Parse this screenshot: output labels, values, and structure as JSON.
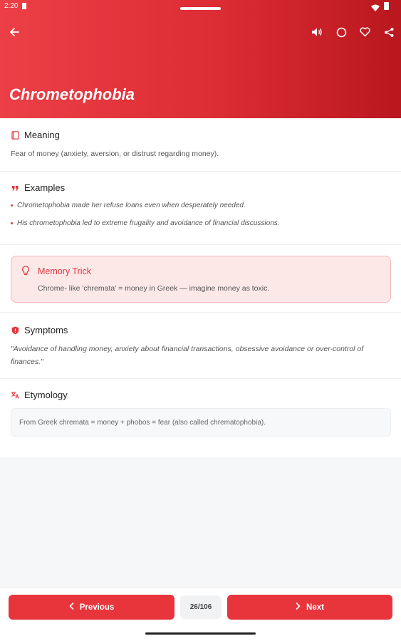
{
  "status_bar": {
    "time": "2:20"
  },
  "header": {
    "title": "Chrometophobia",
    "icons": [
      "back-arrow-icon",
      "speaker-icon",
      "circle-icon",
      "heart-icon",
      "share-icon"
    ]
  },
  "meaning": {
    "heading": "Meaning",
    "text": "Fear of money (anxiety, aversion, or distrust regarding money)."
  },
  "examples": {
    "heading": "Examples",
    "items": [
      "Chrometophobia made her refuse loans even when desperately needed.",
      "His chrometophobia led to extreme frugality and avoidance of financial discussions."
    ]
  },
  "memory_trick": {
    "heading": "Memory Trick",
    "text": "Chrome- like 'chremata' = money in Greek — imagine money as toxic."
  },
  "symptoms": {
    "heading": "Symptoms",
    "text": "\"Avoidance of handling money, anxiety about financial transactions, obsessive avoidance or over-control of finances.\""
  },
  "etymology": {
    "heading": "Etymology",
    "text": "From Greek chremata = money + phobos = fear (also called chrematophobia)."
  },
  "footer": {
    "previous_label": "Previous",
    "next_label": "Next",
    "counter": "26/106"
  },
  "colors": {
    "accent": "#e8353c",
    "header_start": "#ec3f46",
    "header_end": "#b9171e",
    "trick_bg": "#fde8e8"
  }
}
